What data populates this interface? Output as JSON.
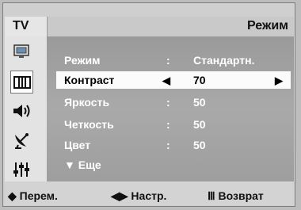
{
  "header": {
    "tv_label": "TV",
    "title": "Режим"
  },
  "sidebar": {
    "items": [
      {
        "icon": "picture-icon"
      },
      {
        "icon": "channel-list-icon",
        "active": true
      },
      {
        "icon": "speaker-icon"
      },
      {
        "icon": "satellite-dish-icon"
      },
      {
        "icon": "equalizer-sliders-icon"
      }
    ]
  },
  "menu": {
    "rows": [
      {
        "label": "Режим",
        "sep": ":",
        "value": "Стандартн."
      },
      {
        "label": "Контраст",
        "value": "70",
        "left_arrow": "◀",
        "right_arrow": "▶",
        "selected": true
      },
      {
        "label": "Яркость",
        "sep": ":",
        "value": "50"
      },
      {
        "label": "Четкость",
        "sep": ":",
        "value": "50"
      },
      {
        "label": "Цвет",
        "sep": ":",
        "value": "50"
      }
    ],
    "more_label": "▼ Еще"
  },
  "footer": {
    "move": "◆ Перем.",
    "adjust": "◀▶ Настр.",
    "return": "Ⅲ Возврат"
  }
}
